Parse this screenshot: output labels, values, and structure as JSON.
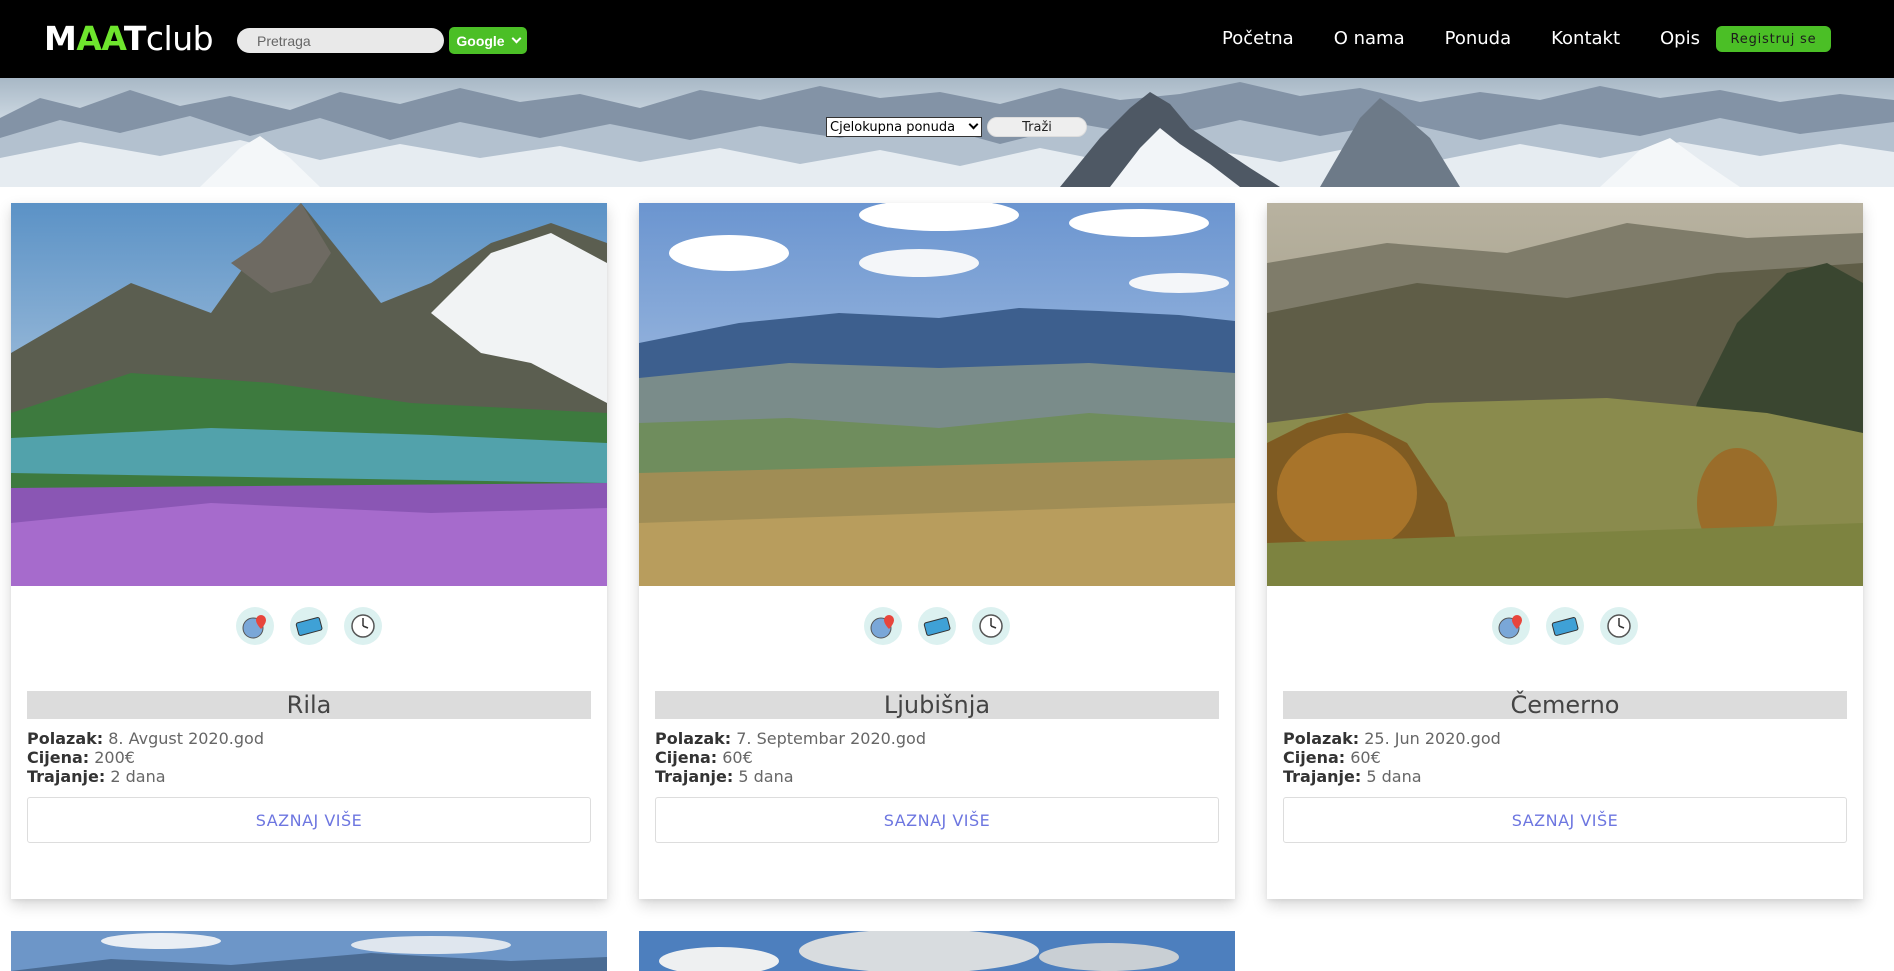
{
  "header": {
    "logo_part1": "M",
    "logo_part2": "AA",
    "logo_part3": "T",
    "logo_part4": "club",
    "search_placeholder": "Pretraga",
    "search_engine": "Google",
    "nav": [
      "Početna",
      "O nama",
      "Ponuda",
      "Kontakt",
      "Opis"
    ],
    "register_label": "Registruj se"
  },
  "filter": {
    "selected_option": "Cjelokupna ponuda",
    "search_button": "Traži"
  },
  "labels": {
    "departure": "Polazak:",
    "price": "Cijena:",
    "duration": "Trajanje:"
  },
  "cards": [
    {
      "title": "Rila",
      "departure": "8. Avgust 2020.god",
      "price": "200€",
      "duration": "2 dana",
      "button": "SAZNAJ VIŠE"
    },
    {
      "title": "Ljubišnja",
      "departure": "7. Septembar 2020.god",
      "price": "60€",
      "duration": "5 dana",
      "button": "SAZNAJ VIŠE"
    },
    {
      "title": "Čemerno",
      "departure": "25. Jun 2020.god",
      "price": "60€",
      "duration": "5 dana",
      "button": "SAZNAJ VIŠE"
    }
  ],
  "icons": [
    "globe-location-icon",
    "ticket-icon",
    "clock-icon"
  ],
  "colors": {
    "accent_green": "#4bbf26",
    "logo_green": "#6ee52d",
    "link_blue": "#6d76e0"
  }
}
